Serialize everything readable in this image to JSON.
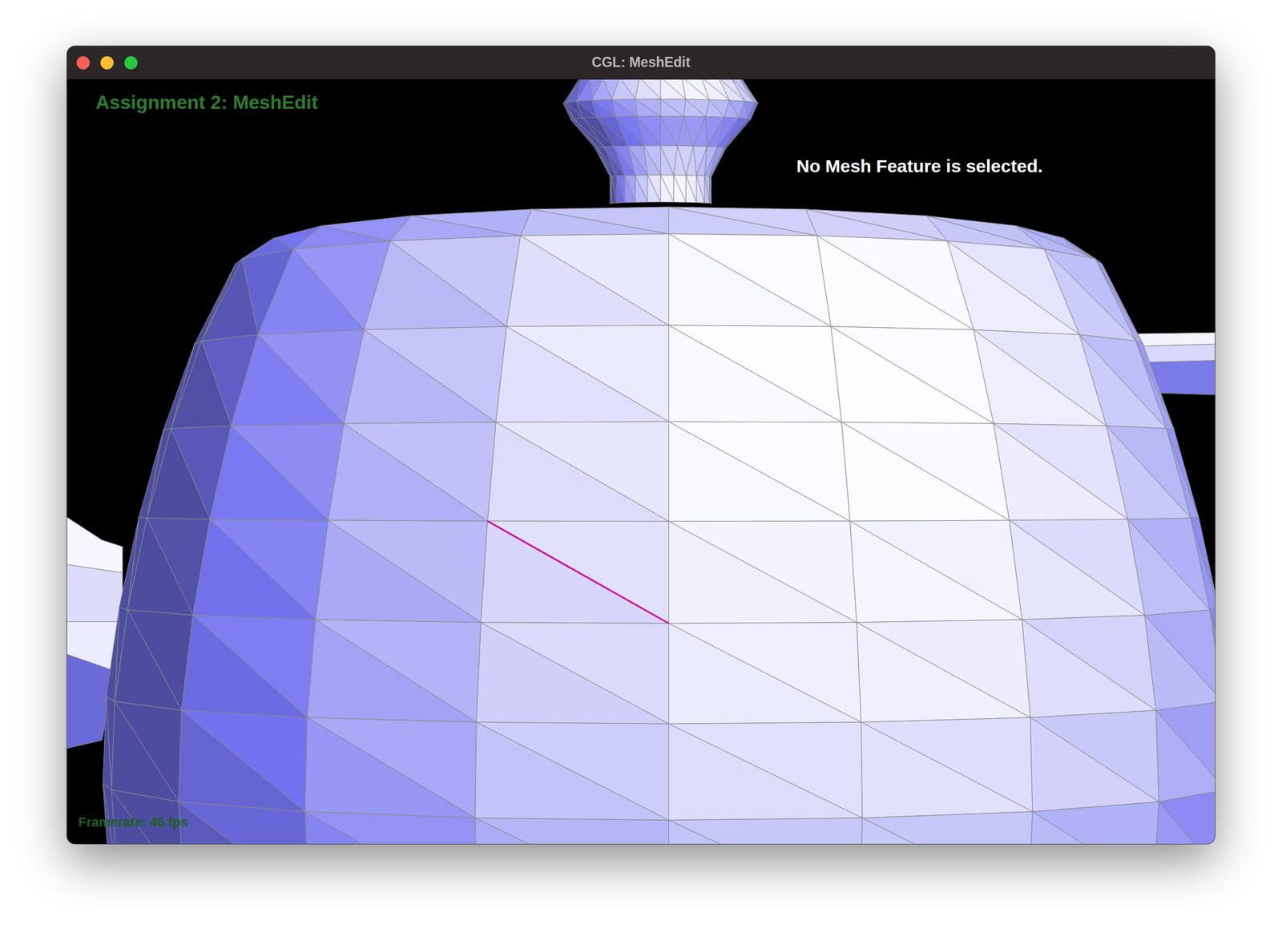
{
  "window": {
    "title": "CGL: MeshEdit"
  },
  "viewport": {
    "heading": "Assignment 2: MeshEdit",
    "selection_status": "No Mesh Feature is selected.",
    "framerate": "Framerate: 46 fps",
    "hovered_edge": true
  }
}
